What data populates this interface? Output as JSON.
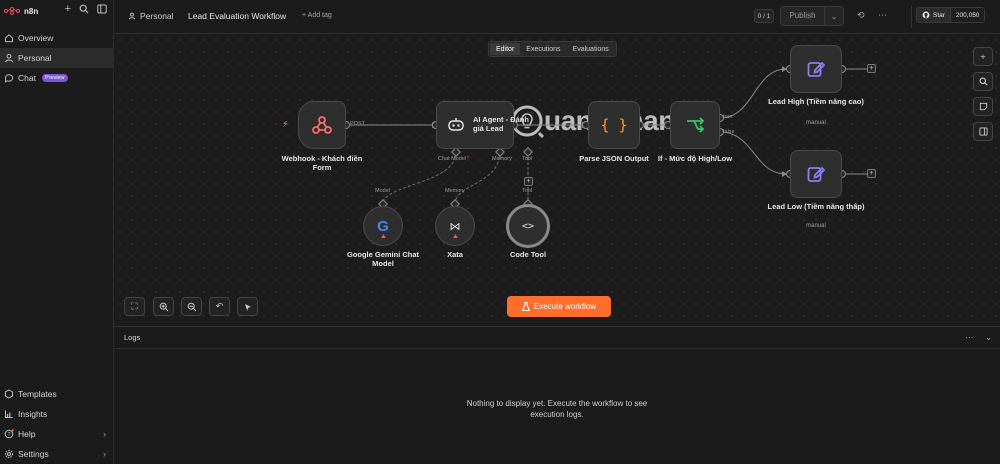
{
  "brand": {
    "name": "n8n"
  },
  "sidebar": {
    "items": [
      {
        "label": "Overview",
        "icon": "home-icon"
      },
      {
        "label": "Personal",
        "icon": "user-icon"
      },
      {
        "label": "Chat",
        "icon": "chat-icon",
        "badge": "Preview"
      }
    ],
    "bottom": [
      {
        "label": "Templates",
        "icon": "templates-icon"
      },
      {
        "label": "Insights",
        "icon": "insights-icon"
      },
      {
        "label": "Help",
        "icon": "help-icon"
      },
      {
        "label": "Settings",
        "icon": "settings-icon"
      }
    ]
  },
  "topbar": {
    "breadcrumb": "Personal",
    "workflow_title": "Lead Evaluation Workflow",
    "add_tag": "+ Add tag",
    "counter": "0 / 1",
    "publish": "Publish",
    "star_label": "Star",
    "star_count": "200,050"
  },
  "canvas": {
    "tabs": [
      "Editor",
      "Executions",
      "Evaluations"
    ],
    "nodes": {
      "webhook": {
        "label": "Webhook - Khách điền Form",
        "port": "POST"
      },
      "agent": {
        "label": "AI Agent - Đánh giá Lead",
        "ports": [
          "Chat Model",
          "Memory",
          "Tool"
        ]
      },
      "parse": {
        "label": "Parse JSON Output"
      },
      "if": {
        "label": "If - Mức độ High/Low",
        "ports": [
          "true",
          "false"
        ]
      },
      "lead_high": {
        "label": "Lead High (Tiềm năng cao)",
        "sub": "manual"
      },
      "lead_low": {
        "label": "Lead Low (Tiềm năng thấp)",
        "sub": "manual"
      },
      "gemini": {
        "label": "Google Gemini Chat Model",
        "port": "Model"
      },
      "xata": {
        "label": "Xata",
        "port": "Memory"
      },
      "code": {
        "label": "Code Tool",
        "port": "Tool"
      }
    },
    "execute_button": "Execute workflow",
    "watermark": "uantrimang",
    "colors": {
      "accent": "#ff6d2d",
      "webhook": "#ff6d6d",
      "parse": "#ff9b26",
      "if": "#35c56b",
      "manual": "#8c7ff2"
    }
  },
  "logs": {
    "title": "Logs",
    "empty_message": "Nothing to display yet. Execute the workflow to see execution logs."
  }
}
